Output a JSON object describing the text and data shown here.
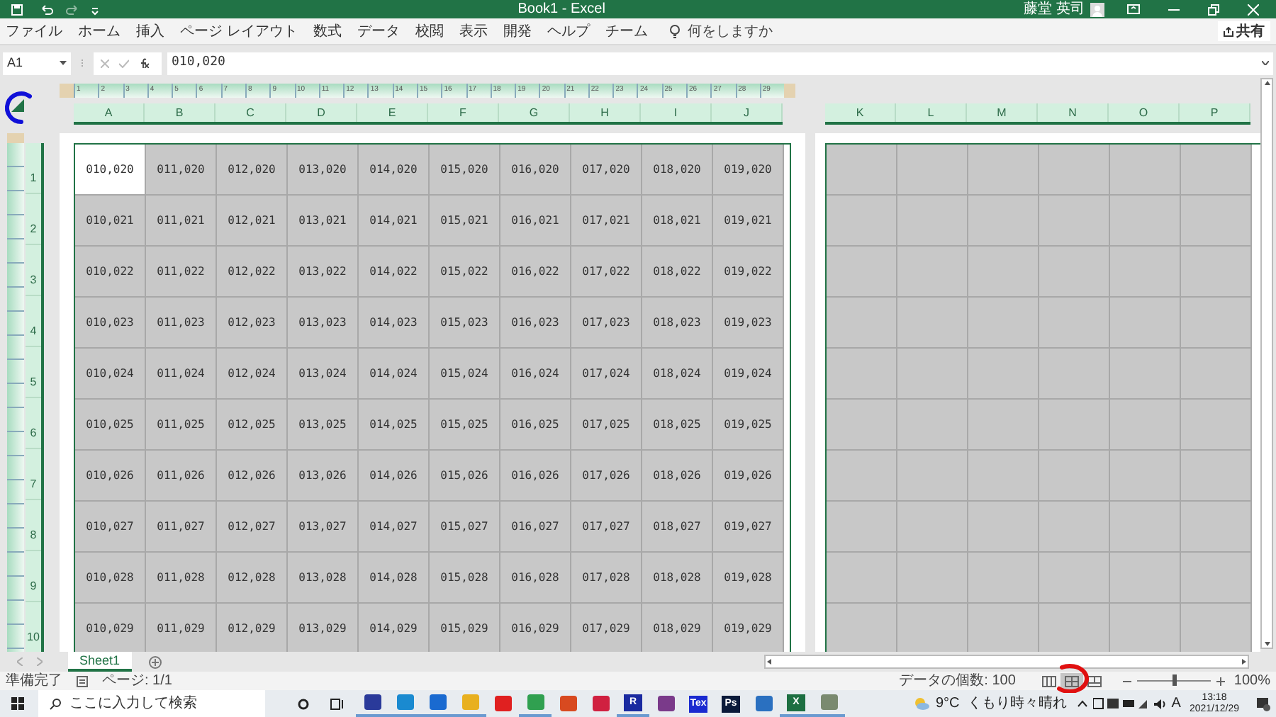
{
  "window": {
    "title": "Book1  -  Excel",
    "user": "藤堂 英司"
  },
  "menu": [
    {
      "label": "ファイル"
    },
    {
      "label": "ホーム"
    },
    {
      "label": "挿入"
    },
    {
      "label": "ページ レイアウト"
    },
    {
      "label": "数式"
    },
    {
      "label": "データ"
    },
    {
      "label": "校閲"
    },
    {
      "label": "表示"
    },
    {
      "label": "開発"
    },
    {
      "label": "ヘルプ"
    },
    {
      "label": "チーム"
    }
  ],
  "tell_me": {
    "placeholder": "何をしますか"
  },
  "share": "共有",
  "formula_bar": {
    "name_box": "A1",
    "value": "010,020"
  },
  "ruler": [
    "1",
    "2",
    "3",
    "4",
    "5",
    "6",
    "7",
    "8",
    "9",
    "10",
    "11",
    "12",
    "13",
    "14",
    "15",
    "16",
    "17",
    "18",
    "19",
    "20",
    "21",
    "22",
    "23",
    "24",
    "25",
    "26",
    "27",
    "28",
    "29"
  ],
  "pages": [
    {
      "columns": [
        "A",
        "B",
        "C",
        "D",
        "E",
        "F",
        "G",
        "H",
        "I",
        "J"
      ],
      "rows": [
        {
          "header": "1",
          "cells": [
            "010,020",
            "011,020",
            "012,020",
            "013,020",
            "014,020",
            "015,020",
            "016,020",
            "017,020",
            "018,020",
            "019,020"
          ]
        },
        {
          "header": "2",
          "cells": [
            "010,021",
            "011,021",
            "012,021",
            "013,021",
            "014,021",
            "015,021",
            "016,021",
            "017,021",
            "018,021",
            "019,021"
          ]
        },
        {
          "header": "3",
          "cells": [
            "010,022",
            "011,022",
            "012,022",
            "013,022",
            "014,022",
            "015,022",
            "016,022",
            "017,022",
            "018,022",
            "019,022"
          ]
        },
        {
          "header": "4",
          "cells": [
            "010,023",
            "011,023",
            "012,023",
            "013,023",
            "014,023",
            "015,023",
            "016,023",
            "017,023",
            "018,023",
            "019,023"
          ]
        },
        {
          "header": "5",
          "cells": [
            "010,024",
            "011,024",
            "012,024",
            "013,024",
            "014,024",
            "015,024",
            "016,024",
            "017,024",
            "018,024",
            "019,024"
          ]
        },
        {
          "header": "6",
          "cells": [
            "010,025",
            "011,025",
            "012,025",
            "013,025",
            "014,025",
            "015,025",
            "016,025",
            "017,025",
            "018,025",
            "019,025"
          ]
        },
        {
          "header": "7",
          "cells": [
            "010,026",
            "011,026",
            "012,026",
            "013,026",
            "014,026",
            "015,026",
            "016,026",
            "017,026",
            "018,026",
            "019,026"
          ]
        },
        {
          "header": "8",
          "cells": [
            "010,027",
            "011,027",
            "012,027",
            "013,027",
            "014,027",
            "015,027",
            "016,027",
            "017,027",
            "018,027",
            "019,027"
          ]
        },
        {
          "header": "9",
          "cells": [
            "010,028",
            "011,028",
            "012,028",
            "013,028",
            "014,028",
            "015,028",
            "016,028",
            "017,028",
            "018,028",
            "019,028"
          ]
        },
        {
          "header": "10",
          "cells": [
            "010,029",
            "011,029",
            "012,029",
            "013,029",
            "014,029",
            "015,029",
            "016,029",
            "017,029",
            "018,029",
            "019,029"
          ]
        }
      ]
    },
    {
      "columns": [
        "K",
        "L",
        "M",
        "N",
        "O",
        "P"
      ]
    }
  ],
  "annotations": [
    {
      "color": "#1010d8"
    },
    {
      "color": "#e01010"
    }
  ],
  "sheet_tabs": [
    {
      "label": "Sheet1",
      "selected": true
    }
  ],
  "status_bar": {
    "ready": "準備完了",
    "page": "ページ: 1/1",
    "count": "データの個数: 100",
    "views": [
      {
        "selected": false
      },
      {
        "selected": true
      },
      {
        "selected": false
      }
    ],
    "zoom": {
      "level": 0.5
    },
    "zoom_label": "100%"
  },
  "taskbar": {
    "search": {
      "placeholder": "ここに入力して検索"
    },
    "apps": [
      {
        "kind": "tile",
        "color": "#2a3a9a",
        "running": true
      },
      {
        "kind": "tile",
        "color": "#1a8ad0",
        "running": true
      },
      {
        "kind": "tile",
        "color": "#1a6ad0",
        "running": true
      },
      {
        "kind": "tile",
        "color": "#e8b020",
        "running": true
      },
      {
        "kind": "tile",
        "color": "#e02020",
        "running": false
      },
      {
        "kind": "tile",
        "color": "#30a050",
        "running": true
      },
      {
        "kind": "tile",
        "color": "#d84a20",
        "running": false
      },
      {
        "kind": "tile",
        "color": "#d02040",
        "running": false
      },
      {
        "kind": "glyph",
        "label": "R",
        "color": "#1a2aa0",
        "running": true
      },
      {
        "kind": "tile",
        "color": "#7a3a8a",
        "running": false
      },
      {
        "kind": "glyph",
        "label": "Tex",
        "color": "#1a2ad0",
        "running": false
      },
      {
        "kind": "glyph",
        "label": "Ps",
        "color": "#0a1a3a",
        "running": false
      },
      {
        "kind": "tile",
        "color": "#2a70c0",
        "running": false
      },
      {
        "kind": "glyph",
        "label": "X",
        "color": "#1d6f42",
        "running": true
      },
      {
        "kind": "tile",
        "color": "#7a8a70",
        "running": true
      }
    ],
    "weather": "9°C  くもり時々晴れ",
    "ime": "A",
    "time": "13:18",
    "date": "2021/12/29"
  }
}
